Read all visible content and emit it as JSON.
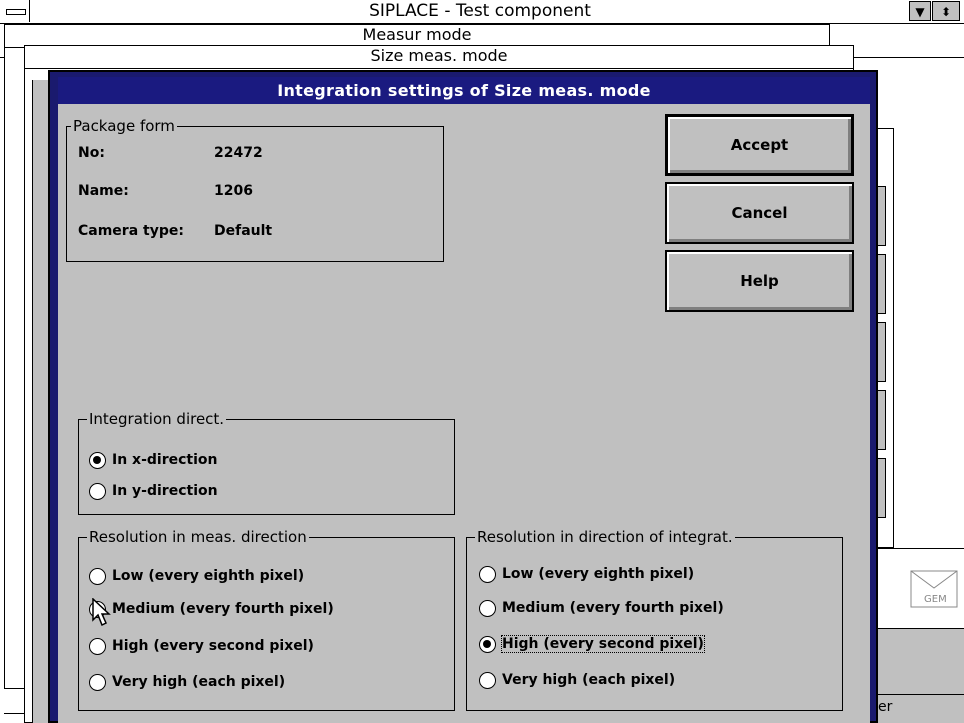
{
  "app": {
    "title": "SIPLACE - Test component",
    "child_windows": [
      "Measur mode",
      "Size meas. mode"
    ]
  },
  "dialog": {
    "title": "Integration settings of Size meas. mode",
    "package_form": {
      "legend": "Package form",
      "fields": [
        {
          "label": "No:",
          "value": "22472"
        },
        {
          "label": "Name:",
          "value": "1206"
        },
        {
          "label": "Camera type:",
          "value": "Default"
        }
      ]
    },
    "buttons": {
      "accept": "Accept",
      "cancel": "Cancel",
      "help": "Help"
    },
    "integration_direction": {
      "legend": "Integration direct.",
      "options": [
        "In x-direction",
        "In y-direction"
      ],
      "selected": "In x-direction"
    },
    "resolution_meas": {
      "legend": "Resolution in meas. direction",
      "options": [
        "Low (every eighth pixel)",
        "Medium (every fourth pixel)",
        "High (every second pixel)",
        "Very high (each pixel)"
      ],
      "selected": "Medium (every fourth pixel)"
    },
    "resolution_integrat": {
      "legend": "Resolution in direction of integrat.",
      "options": [
        "Low (every eighth pixel)",
        "Medium (every fourth pixel)",
        "High (every second pixel)",
        "Very high (each pixel)"
      ],
      "selected": "High (every second pixel)"
    }
  },
  "background": {
    "status_text": "er",
    "gem_label": "GEM"
  },
  "colors": {
    "dialog_frame": "#1a1a6e",
    "caption": "#1a1a80",
    "face": "#c0c0c0"
  }
}
